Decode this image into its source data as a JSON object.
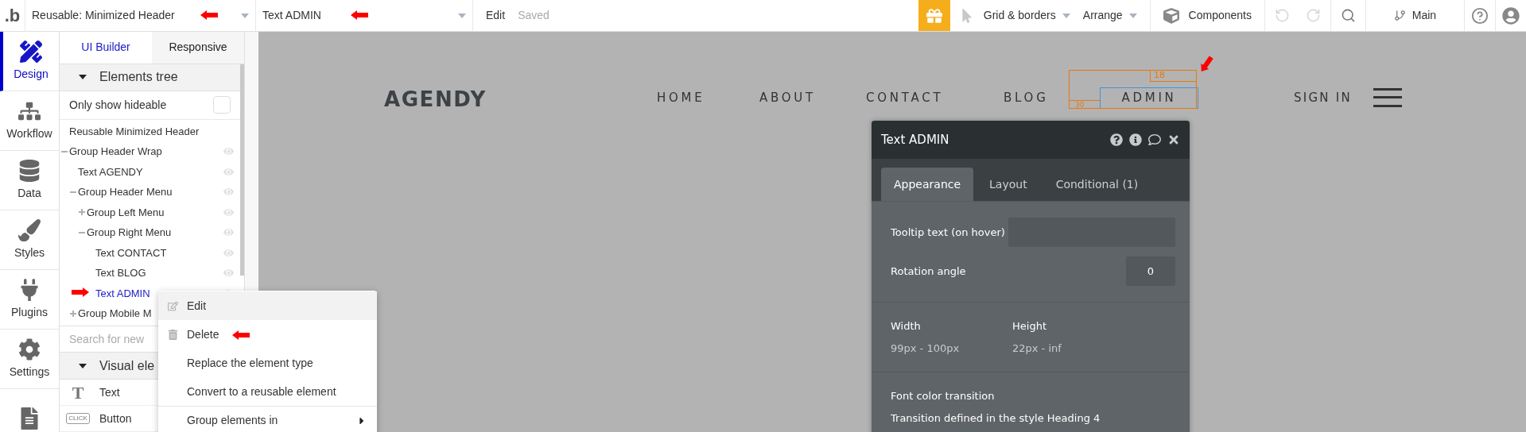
{
  "topbar": {
    "logo": ".b",
    "page_selector": "Reusable: Minimized Header",
    "element_selector": "Text ADMIN",
    "edit": "Edit",
    "status": "Saved",
    "grid_menu": "Grid & borders",
    "arrange_menu": "Arrange",
    "components": "Components",
    "branch": "Main"
  },
  "rail": [
    {
      "kind": "design",
      "label": "Design",
      "selected": true
    },
    {
      "kind": "workflow",
      "label": "Workflow",
      "selected": false
    },
    {
      "kind": "data",
      "label": "Data",
      "selected": false
    },
    {
      "kind": "styles",
      "label": "Styles",
      "selected": false
    },
    {
      "kind": "plugins",
      "label": "Plugins",
      "selected": false
    },
    {
      "kind": "settings",
      "label": "Settings",
      "selected": false
    },
    {
      "kind": "page",
      "selected": false
    }
  ],
  "panel_tabs": [
    {
      "label": "UI Builder",
      "selected": true
    },
    {
      "label": "Responsive",
      "selected": false
    }
  ],
  "elements_tree": {
    "title": "Elements tree",
    "expanded": true,
    "filter": {
      "label": "Only show hideable",
      "checked": false
    },
    "items": [
      {
        "kind": "root",
        "label": "Reusable Minimized Header",
        "selected": false
      },
      {
        "label": "Group Header Wrap",
        "selected": false,
        "expanded": true,
        "children": [
          {
            "label": "Text AGENDY",
            "selected": false
          },
          {
            "label": "Group Header Menu",
            "selected": false,
            "expanded": true,
            "children": [
              {
                "label": "Group Left Menu",
                "selected": false,
                "expanded": false
              },
              {
                "label": "Group Right Menu",
                "selected": false,
                "expanded": true,
                "children": [
                  {
                    "label": "Text CONTACT",
                    "selected": false
                  },
                  {
                    "label": "Text BLOG",
                    "selected": false
                  },
                  {
                    "label": "Text ADMIN",
                    "selected": true
                  }
                ]
              }
            ]
          },
          {
            "label": "Group Mobile M",
            "selected": false,
            "expanded": false
          }
        ]
      }
    ]
  },
  "search": {
    "placeholder": "Search for new"
  },
  "visual_elements": {
    "title": "Visual ele",
    "expanded": true,
    "items": [
      {
        "kind": "text",
        "label": "Text",
        "icon_text": "T"
      },
      {
        "kind": "button",
        "label": "Button",
        "icon_text": "CLICK"
      }
    ]
  },
  "context_menu": [
    {
      "kind": "edit",
      "label": "Edit",
      "highlighted": true
    },
    {
      "kind": "delete",
      "label": "Delete",
      "highlighted": false
    },
    {
      "kind": "plain",
      "label": "Replace the element type",
      "highlighted": false
    },
    {
      "kind": "plain",
      "label": "Convert to a reusable element",
      "highlighted": false
    },
    {
      "kind": "submenu",
      "label": "Group elements in",
      "highlighted": false
    }
  ],
  "canvas": {
    "logo": "AGENDY",
    "nav": [
      {
        "label": "HOME",
        "selected": false
      },
      {
        "label": "ABOUT",
        "selected": false
      },
      {
        "label": "CONTACT",
        "selected": false
      },
      {
        "label": "BLOG",
        "selected": false
      },
      {
        "label": "ADMIN",
        "selected": true
      }
    ],
    "guides": [
      "18",
      "30"
    ],
    "sign_in": "SIGN IN"
  },
  "property_editor": {
    "title": "Text ADMIN",
    "tabs": [
      {
        "label": "Appearance",
        "selected": true
      },
      {
        "label": "Layout",
        "selected": false
      },
      {
        "label": "Conditional (1)",
        "selected": false
      }
    ],
    "tooltip": {
      "label": "Tooltip text (on hover)"
    },
    "rotation": {
      "label": "Rotation angle",
      "value": "0"
    },
    "width": {
      "label": "Width",
      "value": "99px - 100px"
    },
    "height": {
      "label": "Height",
      "value": "22px - inf"
    },
    "transition": {
      "label": "Font color transition",
      "text": "Transition defined in the style Heading 4"
    }
  }
}
